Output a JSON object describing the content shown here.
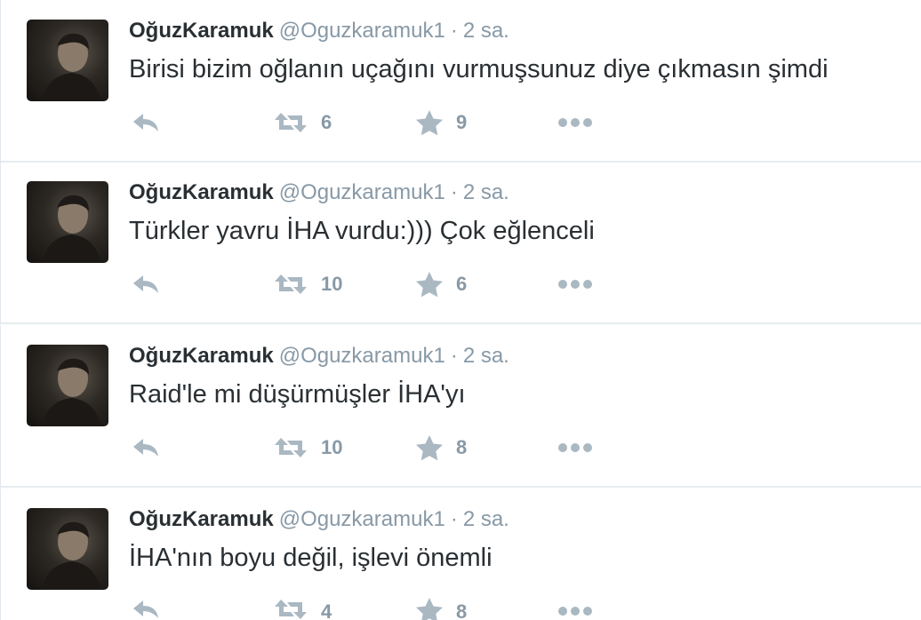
{
  "tweets": [
    {
      "fullname": "OğuzKaramuk",
      "username": "@Oguzkaramuk1",
      "separator": "·",
      "time": "2 sa.",
      "text": "Birisi bizim oğlanın uçağını vurmuşsunuz diye çıkmasın şimdi",
      "retweets": "6",
      "favorites": "9"
    },
    {
      "fullname": "OğuzKaramuk",
      "username": "@Oguzkaramuk1",
      "separator": "·",
      "time": "2 sa.",
      "text": "Türkler yavru İHA vurdu:))) Çok eğlenceli",
      "retweets": "10",
      "favorites": "6"
    },
    {
      "fullname": "OğuzKaramuk",
      "username": "@Oguzkaramuk1",
      "separator": "·",
      "time": "2 sa.",
      "text": "Raid'le mi düşürmüşler İHA'yı",
      "retweets": "10",
      "favorites": "8"
    },
    {
      "fullname": "OğuzKaramuk",
      "username": "@Oguzkaramuk1",
      "separator": "·",
      "time": "2 sa.",
      "text": "İHA'nın boyu değil, işlevi önemli",
      "retweets": "4",
      "favorites": "8"
    }
  ],
  "icons": {
    "reply": "reply-icon",
    "retweet": "retweet-icon",
    "favorite": "star-icon",
    "more": "more-dots-icon",
    "avatar": "avatar-photo"
  },
  "colors": {
    "name": "#292f33",
    "meta": "#8899a6",
    "icon": "#aab8c2",
    "divider": "#e6ecf0"
  }
}
